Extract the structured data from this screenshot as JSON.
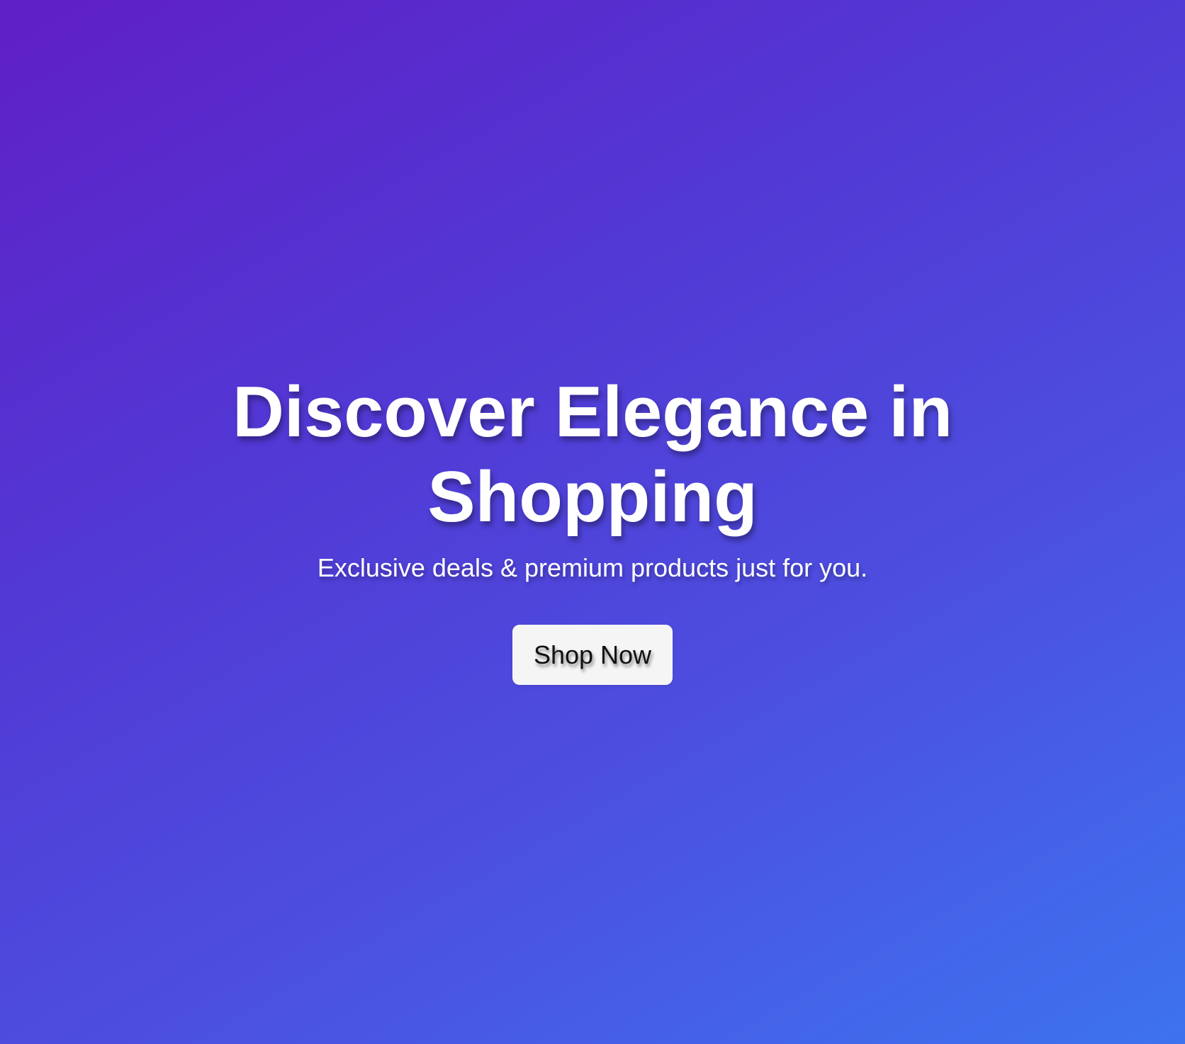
{
  "hero": {
    "title": "Discover Elegance in Shopping",
    "subtitle": "Exclusive deals & premium products just for you.",
    "cta_label": "Shop Now"
  },
  "colors": {
    "gradient_start": "#5f1fc6",
    "gradient_end": "#3d73ef",
    "text": "#ffffff",
    "button_bg": "#f5f5f6",
    "button_text": "#111111"
  }
}
